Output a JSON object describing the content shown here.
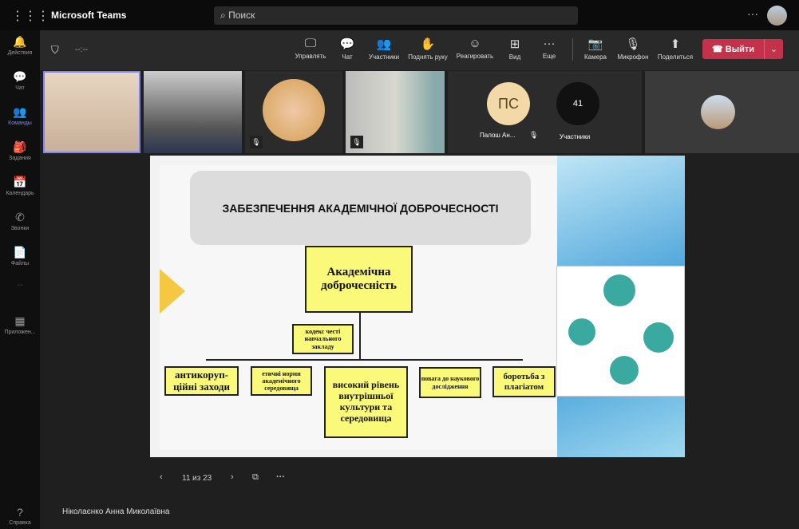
{
  "titlebar": {
    "app": "Microsoft Teams",
    "search_placeholder": "Поиск",
    "more": "···"
  },
  "sidebar": [
    {
      "label": "Действия",
      "icon": "🔔"
    },
    {
      "label": "Чат",
      "icon": "💬"
    },
    {
      "label": "Команды",
      "icon": "👥"
    },
    {
      "label": "Задания",
      "icon": "🎒"
    },
    {
      "label": "Календарь",
      "icon": "📅"
    },
    {
      "label": "Звонки",
      "icon": "✆"
    },
    {
      "label": "Файлы",
      "icon": "📄"
    },
    {
      "label": "···",
      "icon": ""
    },
    {
      "label": "Приложен...",
      "icon": "▦"
    },
    {
      "label": "Справка",
      "icon": "?"
    }
  ],
  "meeting": {
    "timer": "--:--"
  },
  "toolbar": [
    {
      "label": "Управлять",
      "icon": "🖵"
    },
    {
      "label": "Чат",
      "icon": "💬"
    },
    {
      "label": "Участники",
      "icon": "👥"
    },
    {
      "label": "Поднять руку",
      "icon": "✋"
    },
    {
      "label": "Реагировать",
      "icon": "☺"
    },
    {
      "label": "Вид",
      "icon": "⊞"
    },
    {
      "label": "Еще",
      "icon": "···"
    },
    {
      "label": "Камера",
      "icon": "📷"
    },
    {
      "label": "Микрофон",
      "icon": "🎙"
    },
    {
      "label": "Поделиться",
      "icon": "⬆"
    }
  ],
  "leave_label": "Выйти",
  "participants": {
    "initials": "ПС",
    "name": "Палош Ан...",
    "count": "41",
    "count_label": "Участники"
  },
  "slide": {
    "title": "ЗАБЕЗПЕЧЕННЯ АКАДЕМІЧНОЇ ДОБРОЧЕСНОСТІ",
    "root": "Академічна доброчесність",
    "code": "кодекс честі навчального закладу",
    "children": [
      "антикоруп-ційні заходи",
      "етичні норми академічного середовища",
      "високий рівень внутрішньої культури та середовища",
      "повага до наукового дослідження",
      "боротьба з плагіатом"
    ]
  },
  "slide_nav": {
    "page": "11 из 23"
  },
  "presenter": "Ніколаєнко Анна Миколаївна",
  "colors": {
    "leave": "#c4314b",
    "accent": "#7f85f5",
    "box": "#fbf97a"
  }
}
